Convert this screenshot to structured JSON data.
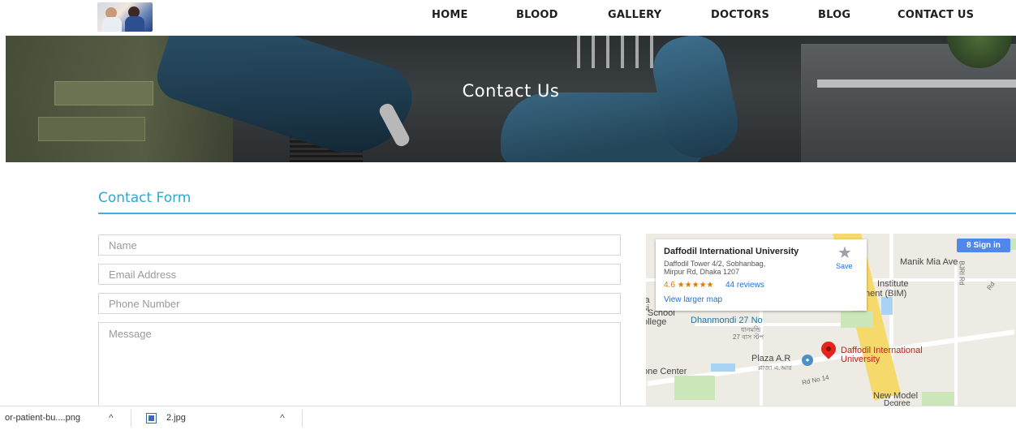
{
  "nav": {
    "items": [
      {
        "label": "HOME"
      },
      {
        "label": "BLOOD"
      },
      {
        "label": "GALLERY"
      },
      {
        "label": "DOCTORS"
      },
      {
        "label": "BLOG"
      },
      {
        "label": "CONTACT US"
      }
    ]
  },
  "hero": {
    "title": "Contact Us"
  },
  "form": {
    "title": "Contact Form",
    "name_placeholder": "Name",
    "email_placeholder": "Email Address",
    "phone_placeholder": "Phone Number",
    "message_placeholder": "Message"
  },
  "map": {
    "card": {
      "title": "Daffodil International University",
      "address_line1": "Daffodil Tower 4/2, Sobhanbag,",
      "address_line2": "Mirpur Rd, Dhaka 1207",
      "rating": "4.6 ★★★★★",
      "reviews": "44 reviews",
      "larger_map": "View larger map",
      "save": "Save"
    },
    "sign_in": "Sign in",
    "labels": {
      "manik": "Manik Mia Ave",
      "institute": "Institute",
      "bim": "nent (BIM)",
      "school": "School",
      "college": "ollege",
      "dhanmondi": "Dhanmondi 27 No",
      "dhanmondi_bn": "ধানমন্ডি",
      "bus_bn": "27 বাস স্টপ",
      "ia": "ia",
      "si": "si",
      "daffodil_1": "Daffodil International",
      "daffodil_2": "University",
      "plaza": "Plaza A.R",
      "plaza_bn": "প্লাজা এ.আর",
      "one_center": "one Center",
      "rd14": "Rd No 14",
      "new_model": "New Model",
      "degree": "Degree",
      "bir_rd": "BJRI Rd",
      "rd_small": "Rd"
    }
  },
  "downloads": {
    "item1": "or-patient-bu....png",
    "item2": "2.jpg"
  },
  "icons": {
    "caret": "^",
    "star": "★",
    "google": "8"
  }
}
